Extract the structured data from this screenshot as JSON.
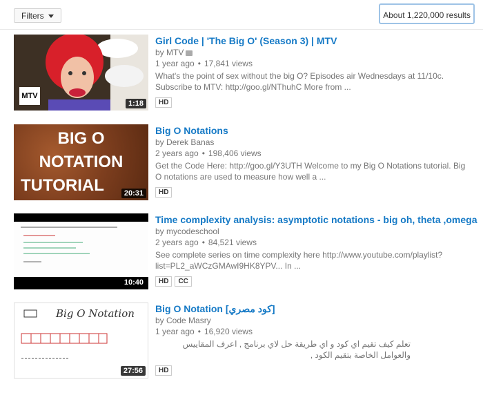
{
  "filters": {
    "label": "Filters"
  },
  "results_count": "About 1,220,000 results",
  "results": [
    {
      "title": "Girl Code | 'The Big O' (Season 3) | MTV",
      "channel": "by MTV",
      "age": "1 year ago",
      "views": "17,841 views",
      "desc_line1": "What's the point of sex without the big O? Episodes air Wednesdays at 11/10c.",
      "desc_line2": "Subscribe to MTV: http://goo.gl/NThuhC More from ...",
      "duration": "1:18",
      "badges": [
        "HD"
      ],
      "thumb_logo": "MTV"
    },
    {
      "title": "Big O Notations",
      "channel": "by Derek Banas",
      "age": "2 years ago",
      "views": "198,406 views",
      "desc_line1": "Get the Code Here: http://goo.gl/Y3UTH Welcome to my Big O Notations tutorial. Big",
      "desc_line2": "O notations are used to measure how well a ...",
      "duration": "20:31",
      "badges": [
        "HD"
      ],
      "thumb_lines": [
        "BIG O",
        "NOTATION",
        "TUTORIAL"
      ]
    },
    {
      "title": "Time complexity analysis: asymptotic notations - big oh, theta ,omega",
      "channel": "by mycodeschool",
      "age": "2 years ago",
      "views": "84,521 views",
      "desc_line1": "See complete series on time complexity here http://www.youtube.com/playlist?",
      "desc_line2": "list=PL2_aWCzGMAwI9HK8YPV... In ...",
      "duration": "10:40",
      "badges": [
        "HD",
        "CC"
      ]
    },
    {
      "title": "Big O Notation [كود مصري]",
      "channel": "by Code Masry",
      "age": "1 year ago",
      "views": "16,920 views",
      "desc_line1": "تعلم كيف تقيم اي كود و اي طريقة حل لاي برنامج , اعرف المقاييس والعوامل الخاصة بتقيم الكود ,",
      "duration": "27:56",
      "badges": [
        "HD"
      ],
      "thumb_text": "Big O Notation"
    }
  ]
}
